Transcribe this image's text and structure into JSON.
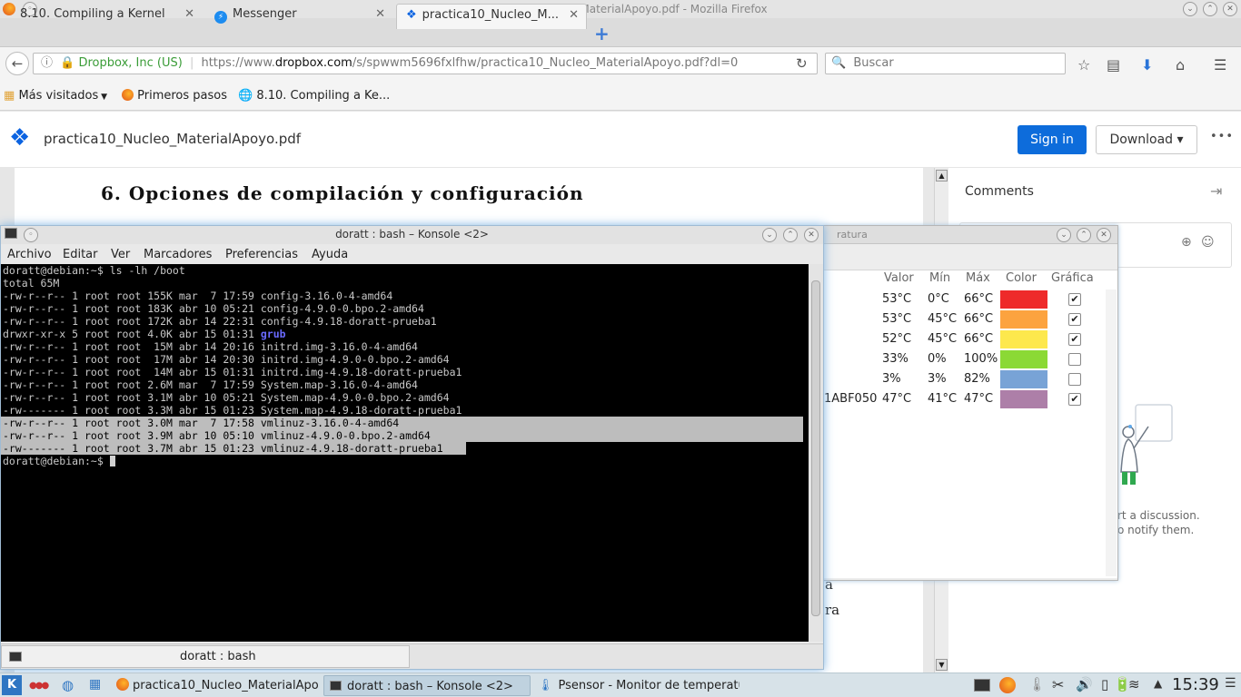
{
  "firefox": {
    "window_title": "practica10_Nucleo_MaterialApoyo.pdf - Mozilla Firefox",
    "tabs": [
      {
        "label": "8.10. Compiling a Kernel"
      },
      {
        "label": "Messenger"
      },
      {
        "label": "practica10_Nucleo_M..."
      }
    ],
    "url_identity": "Dropbox, Inc (US)",
    "url_prefix": "https://www.",
    "url_domain": "dropbox.com",
    "url_path": "/s/spwwm5696fxlfhw/practica10_Nucleo_MaterialApoyo.pdf?dl=0",
    "search_placeholder": "Buscar",
    "bookmarks": [
      "Más visitados",
      "Primeros pasos",
      "8.10. Compiling a Ke..."
    ]
  },
  "dropbox": {
    "filename": "practica10_Nucleo_MaterialApoyo.pdf",
    "sign_in": "Sign in",
    "download": "Download ▾",
    "more": "•••",
    "pdf_heading": "6. Opciones de compilación y configuración",
    "comments_title": "Comments",
    "comments_text_1": "rt a discussion.",
    "comments_text_2": "o notify them.",
    "peek_1": "a",
    "peek_2": "ra"
  },
  "psensor": {
    "title": "ratura",
    "headers": [
      "Valor",
      "Mín",
      "Máx",
      "Color",
      "Gráfica"
    ],
    "rows": [
      {
        "name": "",
        "valor": "53°C",
        "min": "0°C",
        "max": "66°C",
        "color": "#ee2a2a",
        "checked": true
      },
      {
        "name": "",
        "valor": "53°C",
        "min": "45°C",
        "max": "66°C",
        "color": "#fca33f",
        "checked": true
      },
      {
        "name": "",
        "valor": "52°C",
        "min": "45°C",
        "max": "66°C",
        "color": "#fde84d",
        "checked": true
      },
      {
        "name": "",
        "valor": "33%",
        "min": "0%",
        "max": "100%",
        "color": "#8bd935",
        "checked": false
      },
      {
        "name": "",
        "valor": "3%",
        "min": "3%",
        "max": "82%",
        "color": "#78a3d6",
        "checked": false
      },
      {
        "name": "1ABF050",
        "valor": "47°C",
        "min": "41°C",
        "max": "47°C",
        "color": "#ad7fa8",
        "checked": true
      }
    ]
  },
  "konsole": {
    "title": "doratt : bash – Konsole <2>",
    "menu": [
      "Archivo",
      "Editar",
      "Ver",
      "Marcadores",
      "Preferencias",
      "Ayuda"
    ],
    "lines": [
      "doratt@debian:~$ ls -lh /boot",
      "total 65M",
      "-rw-r--r-- 1 root root 155K mar  7 17:59 config-3.16.0-4-amd64",
      "-rw-r--r-- 1 root root 183K abr 10 05:21 config-4.9.0-0.bpo.2-amd64",
      "-rw-r--r-- 1 root root 172K abr 14 22:31 config-4.9.18-doratt-prueba1",
      "drwxr-xr-x 5 root root 4.0K abr 15 01:31 ",
      "-rw-r--r-- 1 root root  15M abr 14 20:16 initrd.img-3.16.0-4-amd64",
      "-rw-r--r-- 1 root root  17M abr 14 20:30 initrd.img-4.9.0-0.bpo.2-amd64",
      "-rw-r--r-- 1 root root  14M abr 15 01:31 initrd.img-4.9.18-doratt-prueba1",
      "-rw-r--r-- 1 root root 2.6M mar  7 17:59 System.map-3.16.0-4-amd64",
      "-rw-r--r-- 1 root root 3.1M abr 10 05:21 System.map-4.9.0-0.bpo.2-amd64",
      "-rw------- 1 root root 3.3M abr 15 01:23 System.map-4.9.18-doratt-prueba1",
      "-rw-r--r-- 1 root root 3.0M mar  7 17:58 vmlinuz-3.16.0-4-amd64",
      "-rw-r--r-- 1 root root 3.9M abr 10 05:10 vmlinuz-4.9.0-0.bpo.2-amd64",
      "-rw------- 1 root root 3.7M abr 15 01:23 vmlinuz-4.9.18-doratt-prueba1",
      "doratt@debian:~$ "
    ],
    "grub": "grub",
    "tab_label": "doratt : bash"
  },
  "taskbar": {
    "tasks": [
      "practica10_Nucleo_MaterialApo",
      "doratt : bash – Konsole <2>",
      "Psensor - Monitor de temperatu"
    ],
    "clock": "15:39"
  }
}
